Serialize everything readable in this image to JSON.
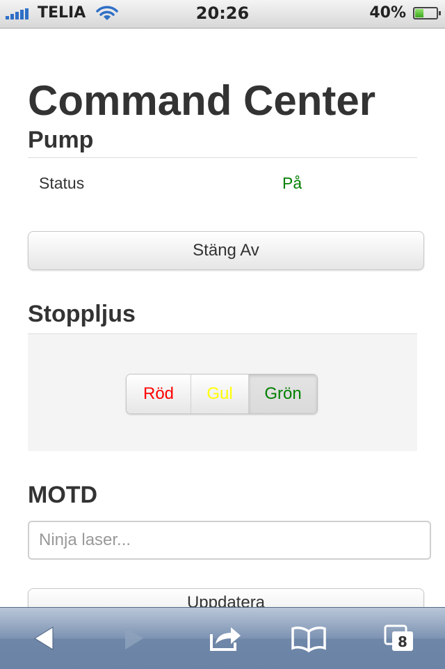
{
  "status_bar": {
    "carrier": "TELIA",
    "time": "20:26",
    "battery_percent": "40%",
    "battery_level": 0.4,
    "signal_icon": "signal-bars-icon",
    "wifi_icon": "wifi-icon",
    "battery_icon": "battery-icon"
  },
  "page": {
    "title": "Command Center"
  },
  "pump": {
    "title": "Pump",
    "status_label": "Status",
    "status_value": "På",
    "status_color": "#008000",
    "toggle_label": "Stäng Av"
  },
  "stoppljus": {
    "title": "Stoppljus",
    "buttons": [
      {
        "label": "Röd",
        "color": "#ff0000"
      },
      {
        "label": "Gul",
        "color": "#ffff00"
      },
      {
        "label": "Grön",
        "color": "#008000",
        "active": true
      }
    ]
  },
  "motd": {
    "title": "MOTD",
    "input_value": "",
    "input_placeholder": "Ninja laser...",
    "update_label": "Uppdatera"
  },
  "toolbar": {
    "icons": [
      "back-arrow-icon",
      "forward-arrow-icon",
      "share-icon",
      "bookmarks-icon",
      "tabs-icon"
    ],
    "tab_count": "8"
  }
}
